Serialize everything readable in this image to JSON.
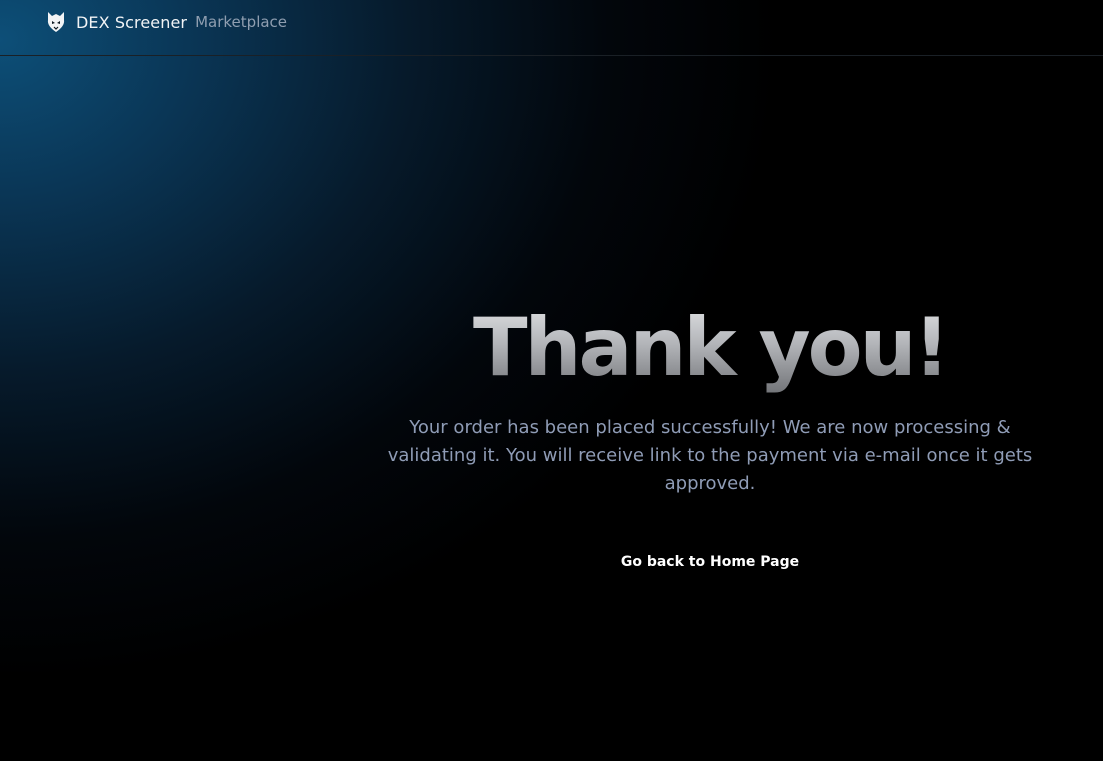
{
  "header": {
    "logo_icon": "dex-screener-logo-icon",
    "brand_name": "DEX Screener",
    "brand_subtitle": "Marketplace"
  },
  "hero": {
    "title": "Thank you!",
    "message": "Your order has been placed successfully! We are now processing & validating it. You will receive link to the payment via e-mail once it gets approved.",
    "home_link_label": "Go back to Home Page"
  },
  "colors": {
    "background": "#000000",
    "accent_glow": "#0d4f78",
    "message_text": "#8f9cb6",
    "subtitle_text": "#8f9eb0"
  }
}
